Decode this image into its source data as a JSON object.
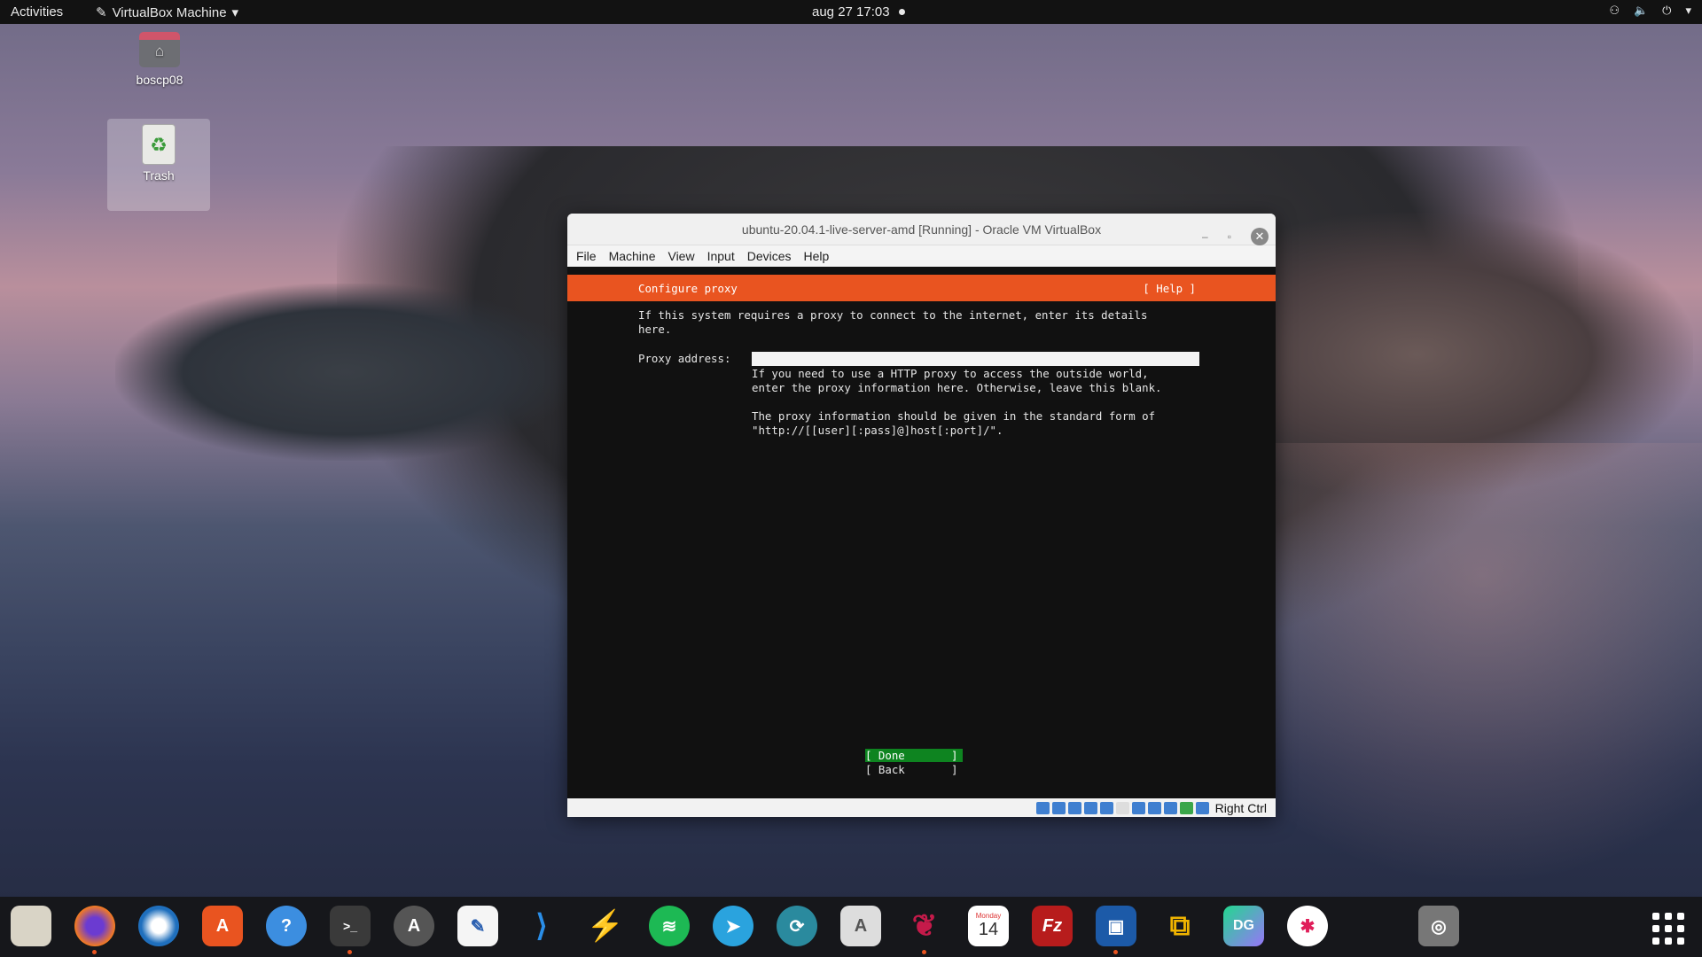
{
  "topbar": {
    "activities": "Activities",
    "app_menu": "VirtualBox Machine",
    "clock": "aug 27  17:03"
  },
  "desktop": {
    "home_label": "boscp08",
    "trash_label": "Trash"
  },
  "window": {
    "title": "ubuntu-20.04.1-live-server-amd [Running] - Oracle VM VirtualBox",
    "menu": [
      "File",
      "Machine",
      "View",
      "Input",
      "Devices",
      "Help"
    ],
    "host_key": "Right Ctrl"
  },
  "installer": {
    "header_title": "Configure proxy",
    "help": "[ Help ]",
    "intro_line1": "If this system requires a proxy to connect to the internet, enter its details",
    "intro_line2": "here.",
    "proxy_label": "Proxy address:",
    "proxy_value": "",
    "hint_line1": "If you need to use a HTTP proxy to access the outside world,",
    "hint_line2": "enter the proxy information here. Otherwise, leave this blank.",
    "hint_line3": "The proxy information should be given in the standard form of",
    "hint_line4": "\"http://[[user][:pass]@]host[:port]/\".",
    "done": "[ Done       ]",
    "back": "[ Back       ]"
  },
  "dock": {
    "items": [
      "files-icon",
      "firefox-icon",
      "thunderbird-icon",
      "software-icon",
      "help-icon",
      "terminal-icon",
      "updater-icon",
      "text-editor-icon",
      "vscode-icon",
      "bolt-icon",
      "spotify-icon",
      "telegram-icon",
      "remote-icon",
      "document-viewer-icon",
      "raspberry-icon",
      "calendar-icon",
      "filezilla-icon",
      "virtualbox-icon",
      "vmware-icon",
      "datagrip-icon",
      "slack-icon",
      "disk-icon"
    ],
    "calendar_day": "Monday",
    "calendar_date": "14"
  },
  "colors": {
    "header_orange": "#e95420",
    "done_green": "#0e8420"
  }
}
